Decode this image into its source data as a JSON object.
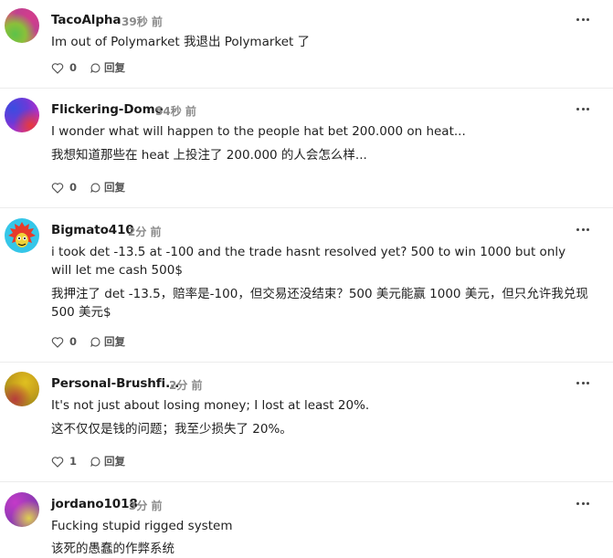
{
  "actions": {
    "reply_label": "回复"
  },
  "comments": [
    {
      "username": "TacoAlpha",
      "time": "39秒 前",
      "lines": [
        "Im out of Polymarket  我退出 Polymarket 了"
      ],
      "likes": "0",
      "avatar_colors": [
        "#d43c8c",
        "#5cc24a",
        "#f0a640"
      ]
    },
    {
      "username": "Flickering-Dome",
      "time": "54秒 前",
      "lines": [
        "I wonder what will happen to the people hat bet 200.000 on heat...",
        "我想知道那些在 heat 上投注了 200.000 的人会怎么样..."
      ],
      "likes": "0",
      "avatar_colors": [
        "#3a4de0",
        "#c42cc8",
        "#e63a3a"
      ]
    },
    {
      "username": "Bigmato410",
      "time": "2分 前",
      "lines": [
        "i took det -13.5 at -100 and the trade hasnt resolved yet?  500 to win 1000 but only will let me cash 500$",
        "我押注了 det -13.5，赔率是-100，但交易还没结束？500 美元能赢 1000 美元，但只允许我兑现 500 美元$"
      ],
      "likes": "0",
      "avatar_colors": [
        "#35c6e8",
        "#e83a2a",
        "#f0d23a"
      ]
    },
    {
      "username": "Personal-Brushfi...",
      "time": "2分 前",
      "lines": [
        "It's not just about losing money; I lost at least 20%.",
        "这不仅仅是钱的问题；我至少损失了 20%。"
      ],
      "likes": "1",
      "avatar_colors": [
        "#c9a21c",
        "#9a8a1a",
        "#b83c3c"
      ]
    },
    {
      "username": "jordano1018",
      "time": "3分 前",
      "lines": [
        "Fucking stupid rigged system",
        "该死的愚蠢的作弊系统"
      ],
      "likes": "",
      "avatar_colors": [
        "#c43ac8",
        "#e0d050",
        "#7a3aa8"
      ]
    }
  ]
}
